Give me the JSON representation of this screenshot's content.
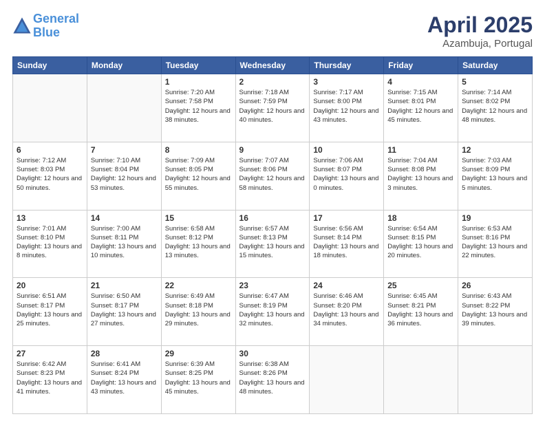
{
  "header": {
    "logo_line1": "General",
    "logo_line2": "Blue",
    "month": "April 2025",
    "location": "Azambuja, Portugal"
  },
  "weekdays": [
    "Sunday",
    "Monday",
    "Tuesday",
    "Wednesday",
    "Thursday",
    "Friday",
    "Saturday"
  ],
  "weeks": [
    [
      {
        "day": "",
        "info": ""
      },
      {
        "day": "",
        "info": ""
      },
      {
        "day": "1",
        "info": "Sunrise: 7:20 AM\nSunset: 7:58 PM\nDaylight: 12 hours\nand 38 minutes."
      },
      {
        "day": "2",
        "info": "Sunrise: 7:18 AM\nSunset: 7:59 PM\nDaylight: 12 hours\nand 40 minutes."
      },
      {
        "day": "3",
        "info": "Sunrise: 7:17 AM\nSunset: 8:00 PM\nDaylight: 12 hours\nand 43 minutes."
      },
      {
        "day": "4",
        "info": "Sunrise: 7:15 AM\nSunset: 8:01 PM\nDaylight: 12 hours\nand 45 minutes."
      },
      {
        "day": "5",
        "info": "Sunrise: 7:14 AM\nSunset: 8:02 PM\nDaylight: 12 hours\nand 48 minutes."
      }
    ],
    [
      {
        "day": "6",
        "info": "Sunrise: 7:12 AM\nSunset: 8:03 PM\nDaylight: 12 hours\nand 50 minutes."
      },
      {
        "day": "7",
        "info": "Sunrise: 7:10 AM\nSunset: 8:04 PM\nDaylight: 12 hours\nand 53 minutes."
      },
      {
        "day": "8",
        "info": "Sunrise: 7:09 AM\nSunset: 8:05 PM\nDaylight: 12 hours\nand 55 minutes."
      },
      {
        "day": "9",
        "info": "Sunrise: 7:07 AM\nSunset: 8:06 PM\nDaylight: 12 hours\nand 58 minutes."
      },
      {
        "day": "10",
        "info": "Sunrise: 7:06 AM\nSunset: 8:07 PM\nDaylight: 13 hours\nand 0 minutes."
      },
      {
        "day": "11",
        "info": "Sunrise: 7:04 AM\nSunset: 8:08 PM\nDaylight: 13 hours\nand 3 minutes."
      },
      {
        "day": "12",
        "info": "Sunrise: 7:03 AM\nSunset: 8:09 PM\nDaylight: 13 hours\nand 5 minutes."
      }
    ],
    [
      {
        "day": "13",
        "info": "Sunrise: 7:01 AM\nSunset: 8:10 PM\nDaylight: 13 hours\nand 8 minutes."
      },
      {
        "day": "14",
        "info": "Sunrise: 7:00 AM\nSunset: 8:11 PM\nDaylight: 13 hours\nand 10 minutes."
      },
      {
        "day": "15",
        "info": "Sunrise: 6:58 AM\nSunset: 8:12 PM\nDaylight: 13 hours\nand 13 minutes."
      },
      {
        "day": "16",
        "info": "Sunrise: 6:57 AM\nSunset: 8:13 PM\nDaylight: 13 hours\nand 15 minutes."
      },
      {
        "day": "17",
        "info": "Sunrise: 6:56 AM\nSunset: 8:14 PM\nDaylight: 13 hours\nand 18 minutes."
      },
      {
        "day": "18",
        "info": "Sunrise: 6:54 AM\nSunset: 8:15 PM\nDaylight: 13 hours\nand 20 minutes."
      },
      {
        "day": "19",
        "info": "Sunrise: 6:53 AM\nSunset: 8:16 PM\nDaylight: 13 hours\nand 22 minutes."
      }
    ],
    [
      {
        "day": "20",
        "info": "Sunrise: 6:51 AM\nSunset: 8:17 PM\nDaylight: 13 hours\nand 25 minutes."
      },
      {
        "day": "21",
        "info": "Sunrise: 6:50 AM\nSunset: 8:17 PM\nDaylight: 13 hours\nand 27 minutes."
      },
      {
        "day": "22",
        "info": "Sunrise: 6:49 AM\nSunset: 8:18 PM\nDaylight: 13 hours\nand 29 minutes."
      },
      {
        "day": "23",
        "info": "Sunrise: 6:47 AM\nSunset: 8:19 PM\nDaylight: 13 hours\nand 32 minutes."
      },
      {
        "day": "24",
        "info": "Sunrise: 6:46 AM\nSunset: 8:20 PM\nDaylight: 13 hours\nand 34 minutes."
      },
      {
        "day": "25",
        "info": "Sunrise: 6:45 AM\nSunset: 8:21 PM\nDaylight: 13 hours\nand 36 minutes."
      },
      {
        "day": "26",
        "info": "Sunrise: 6:43 AM\nSunset: 8:22 PM\nDaylight: 13 hours\nand 39 minutes."
      }
    ],
    [
      {
        "day": "27",
        "info": "Sunrise: 6:42 AM\nSunset: 8:23 PM\nDaylight: 13 hours\nand 41 minutes."
      },
      {
        "day": "28",
        "info": "Sunrise: 6:41 AM\nSunset: 8:24 PM\nDaylight: 13 hours\nand 43 minutes."
      },
      {
        "day": "29",
        "info": "Sunrise: 6:39 AM\nSunset: 8:25 PM\nDaylight: 13 hours\nand 45 minutes."
      },
      {
        "day": "30",
        "info": "Sunrise: 6:38 AM\nSunset: 8:26 PM\nDaylight: 13 hours\nand 48 minutes."
      },
      {
        "day": "",
        "info": ""
      },
      {
        "day": "",
        "info": ""
      },
      {
        "day": "",
        "info": ""
      }
    ]
  ]
}
